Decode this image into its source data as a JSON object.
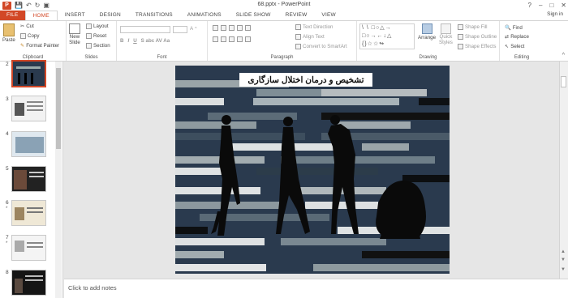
{
  "app": {
    "title": "68.pptx - PowerPoint",
    "logo": "P",
    "window_controls": [
      "?",
      "–",
      "□",
      "✕"
    ]
  },
  "ribbon_tabs": [
    "FILE",
    "HOME",
    "INSERT",
    "DESIGN",
    "TRANSITIONS",
    "ANIMATIONS",
    "SLIDE SHOW",
    "REVIEW",
    "VIEW"
  ],
  "sign_in": "Sign in",
  "clipboard": {
    "paste": "Paste",
    "cut": "Cut",
    "copy": "Copy",
    "format_painter": "Format Painter",
    "label": "Clipboard"
  },
  "slides_group": {
    "new_slide": "New",
    "new_slide2": "Slide",
    "layout": "Layout",
    "reset": "Reset",
    "section": "Section",
    "label": "Slides"
  },
  "font_group": {
    "label": "Font"
  },
  "paragraph_group": {
    "text_direction": "Text Direction",
    "align_text": "Align Text",
    "convert_smartart": "Convert to SmartArt",
    "label": "Paragraph"
  },
  "drawing_group": {
    "arrange": "Arrange",
    "quick_styles": "Quick",
    "quick_styles2": "Styles",
    "shape_fill": "Shape Fill",
    "shape_outline": "Shape Outline",
    "shape_effects": "Shape Effects",
    "label": "Drawing"
  },
  "editing_group": {
    "find": "Find",
    "replace": "Replace",
    "select": "Select",
    "label": "Editing"
  },
  "thumbnails": [
    {
      "num": "2",
      "selected": true
    },
    {
      "num": "3"
    },
    {
      "num": "4"
    },
    {
      "num": "5"
    },
    {
      "num": "6",
      "star": "*"
    },
    {
      "num": "7",
      "star": "*"
    },
    {
      "num": "8"
    }
  ],
  "slide": {
    "title": "تشخیص و درمان اختلال سازگاری"
  },
  "notes_placeholder": "Click to add notes",
  "colors": {
    "accent": "#d24726",
    "slide_bg": "#2a3a4e"
  },
  "icons": [
    "ppt-logo-icon",
    "save-icon",
    "undo-icon",
    "redo-icon",
    "slideshow-icon",
    "paste-icon",
    "cut-icon",
    "copy-icon",
    "format-painter-icon",
    "find-icon"
  ]
}
